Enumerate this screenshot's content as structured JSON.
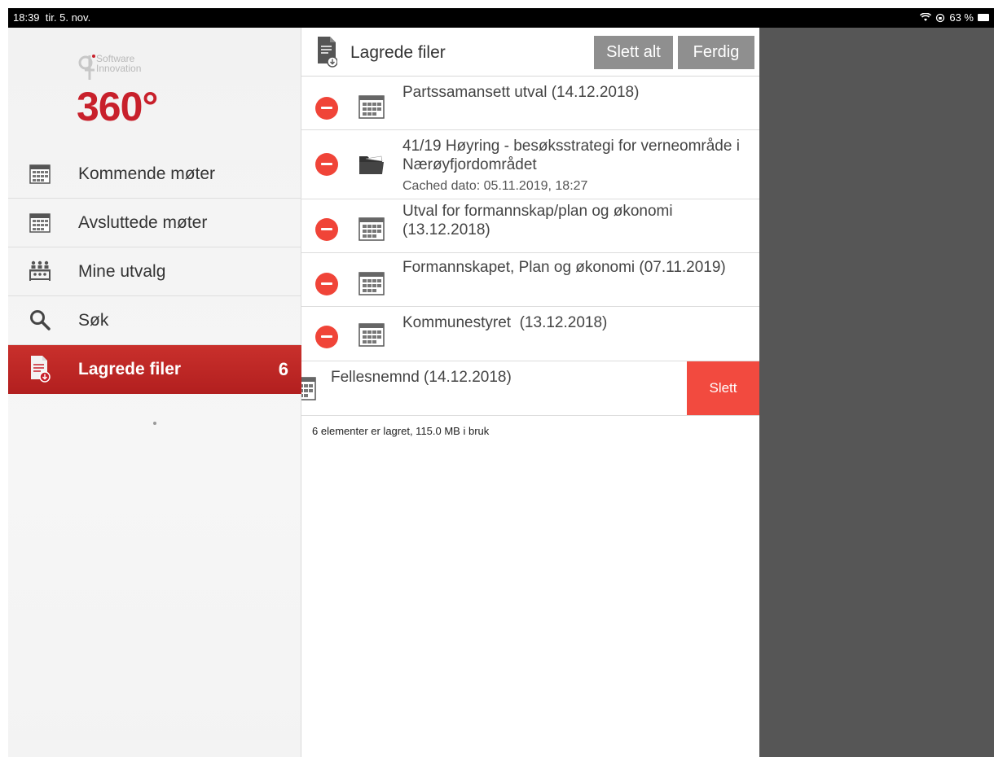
{
  "status": {
    "time": "18:39",
    "date": "tir. 5. nov.",
    "battery": "63 %",
    "wifi_icon": "wifi-icon",
    "lock_icon": "rotation-lock-icon"
  },
  "logo": {
    "brand": [
      "Software",
      "Innovation"
    ],
    "big": "360°"
  },
  "sidebar": {
    "items": [
      {
        "label": "Kommende møter",
        "icon": "calendar-icon"
      },
      {
        "label": "Avsluttede møter",
        "icon": "calendar-icon"
      },
      {
        "label": "Mine utvalg",
        "icon": "group-icon"
      },
      {
        "label": "Søk",
        "icon": "search-icon"
      },
      {
        "label": "Lagrede filer",
        "icon": "saved-file-icon",
        "count": "6",
        "active": true
      }
    ]
  },
  "header": {
    "title": "Lagrede filer",
    "delete_all": "Slett alt",
    "done": "Ferdig"
  },
  "files": [
    {
      "title": "Partssamansett utval (14.12.2018)",
      "icon": "calendar-icon"
    },
    {
      "title": "41/19 Høyring - besøksstrategi for verneområde i Nærøyfjordområdet",
      "sub": "Cached dato: 05.11.2019, 18:27",
      "icon": "folder-icon"
    },
    {
      "title": "Utval for formannskap/plan og økonomi (13.12.2018)",
      "icon": "calendar-icon"
    },
    {
      "title": "Formannskapet, Plan og økonomi (07.11.2019)",
      "icon": "calendar-icon"
    },
    {
      "title": "Kommunestyret  (13.12.2018)",
      "icon": "calendar-icon"
    }
  ],
  "swiped": {
    "title": "Fellesnemnd (14.12.2018)",
    "delete": "Slett",
    "icon": "calendar-icon"
  },
  "footer": {
    "note": "6 elementer er lagret, 115.0 MB i bruk"
  },
  "colors": {
    "accent": "#c8202b",
    "delete": "#f24a3f",
    "button": "#8f8f8f",
    "pane": "#565656"
  }
}
